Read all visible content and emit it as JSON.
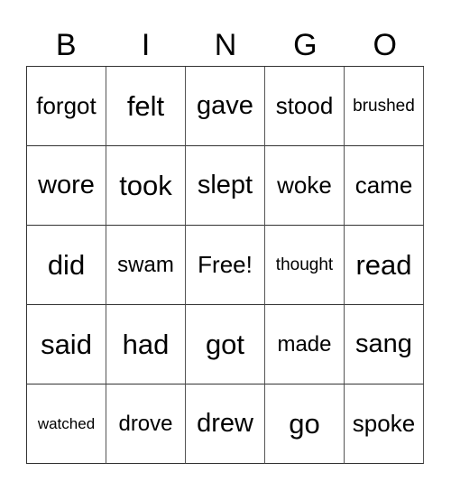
{
  "header": [
    "B",
    "I",
    "N",
    "G",
    "O"
  ],
  "rows": [
    [
      "forgot",
      "felt",
      "gave",
      "stood",
      "brushed"
    ],
    [
      "wore",
      "took",
      "slept",
      "woke",
      "came"
    ],
    [
      "did",
      "swam",
      "Free!",
      "thought",
      "read"
    ],
    [
      "said",
      "had",
      "got",
      "made",
      "sang"
    ],
    [
      "watched",
      "drove",
      "drew",
      "go",
      "spoke"
    ]
  ]
}
